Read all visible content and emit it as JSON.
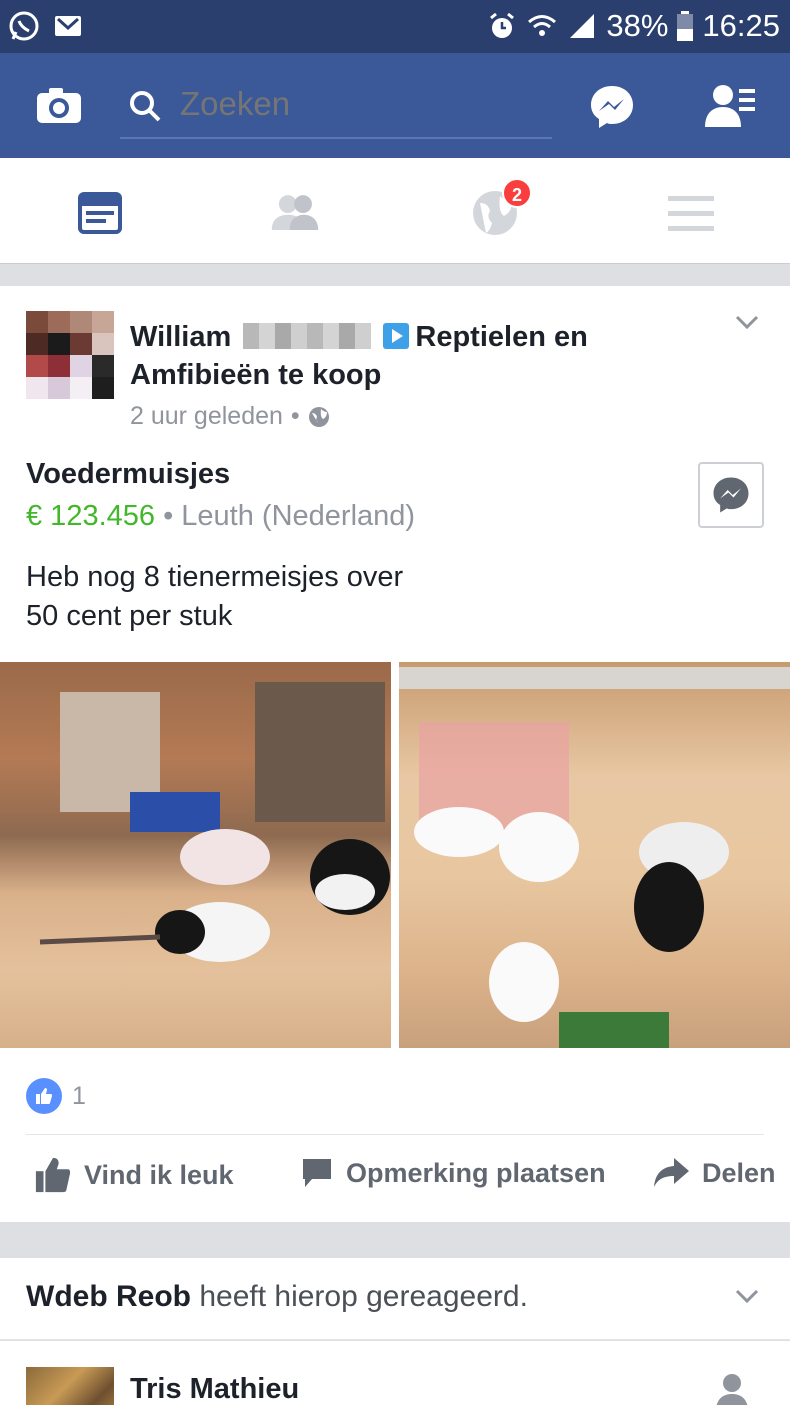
{
  "status_bar": {
    "battery": "38%",
    "time": "16:25"
  },
  "navbar": {
    "search_placeholder": "Zoeken"
  },
  "tabs": {
    "notifications_badge": "2"
  },
  "post": {
    "author": "William",
    "group": "Reptielen en Amfibieën te koop",
    "time": "2 uur geleden",
    "sep": "•",
    "item_title": "Voedermuisjes",
    "price": "€ 123.456",
    "price_sep": " • ",
    "location": "Leuth (Nederland)",
    "body_line1": "Heb nog 8 tienermeisjes over",
    "body_line2": "50 cent per stuk",
    "like_count": "1",
    "actions": {
      "like": "Vind ik leuk",
      "comment": "Opmerking plaatsen",
      "share": "Delen"
    }
  },
  "reaction_card": {
    "name": "Wdeb Reob",
    "text": " heeft hierop gereageerd."
  },
  "next_post": {
    "author": "Tris Mathieu"
  },
  "colors": {
    "status_bar": "#2b3f6e",
    "navbar": "#3b5998",
    "price_green": "#42b72a",
    "badge_red": "#fa3e3e",
    "like_blue": "#5890ff"
  }
}
